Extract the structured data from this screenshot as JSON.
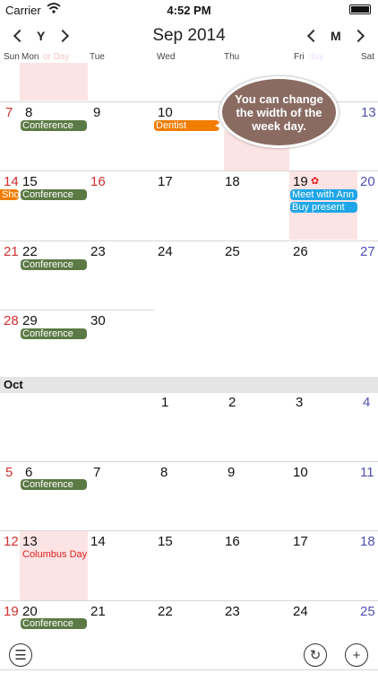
{
  "status_bar": {
    "carrier": "Carrier",
    "time": "4:52 PM"
  },
  "nav": {
    "year_label": "Y",
    "month_label": "M",
    "title": "Sep 2014"
  },
  "weekdays": [
    "Sun",
    "Mon",
    "Tue",
    "Wed",
    "Thu",
    "Fri",
    "Sat"
  ],
  "ghost": {
    "mon": "or Day",
    "fri": "day"
  },
  "tip": "You can change the width of the week day.",
  "dates": {
    "r1": [
      "7",
      "8",
      "9",
      "10",
      "",
      "",
      "13"
    ],
    "r2": [
      "14",
      "15",
      "16",
      "17",
      "18",
      "19",
      "20"
    ],
    "r3": [
      "21",
      "22",
      "23",
      "24",
      "25",
      "26",
      "27"
    ],
    "r4": [
      "28",
      "29",
      "30"
    ],
    "oct": {
      "r1": [
        "1",
        "2",
        "3",
        "4"
      ],
      "r2": [
        "5",
        "6",
        "7",
        "8",
        "9",
        "10",
        "11"
      ],
      "r3": [
        "12",
        "13",
        "14",
        "15",
        "16",
        "17",
        "18"
      ],
      "r4": [
        "19",
        "20",
        "21",
        "22",
        "23",
        "24",
        "25"
      ]
    }
  },
  "month_divider": "Oct",
  "events": {
    "conference": "Conference",
    "dentist": "Dentist",
    "sho": "Sho",
    "meet": "Meet with Ann",
    "buy": "Buy present",
    "columbus": "Columbus Day"
  },
  "colors": {
    "conference": "#5b7a45",
    "dentist": "#f07c00",
    "meet": "#1ea6e8",
    "highlight": "#fde4e4"
  }
}
